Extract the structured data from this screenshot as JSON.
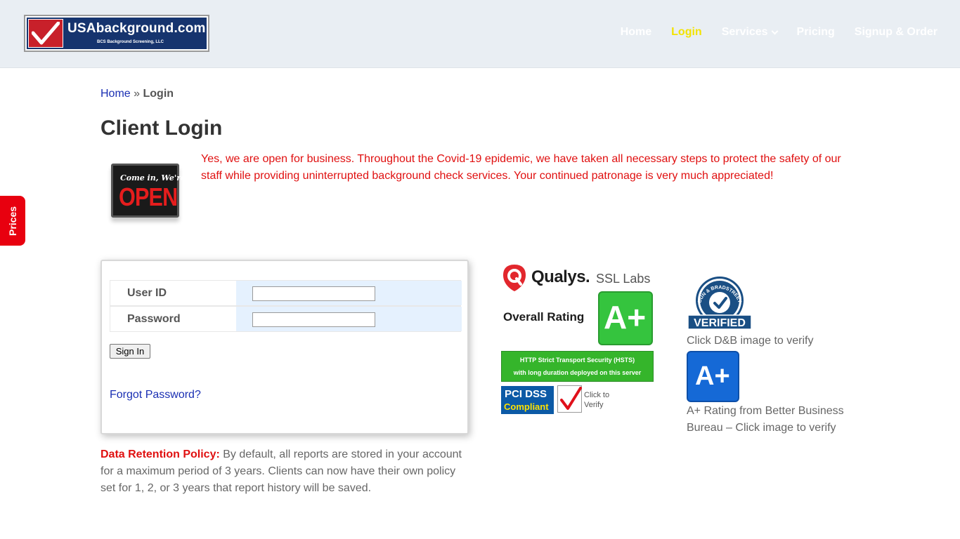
{
  "header": {
    "logo": {
      "title": "USAbackground.com",
      "subtitle": "BCS Background Screening, LLC"
    },
    "nav": [
      {
        "label": "Home",
        "active": false
      },
      {
        "label": "Login",
        "active": true
      },
      {
        "label": "Services",
        "active": false,
        "has_dropdown": true
      },
      {
        "label": "Pricing",
        "active": false
      },
      {
        "label": "Signup & Order",
        "active": false
      }
    ]
  },
  "side_tab": {
    "label": "Prices"
  },
  "breadcrumb": {
    "home": "Home",
    "separator": "»",
    "current": "Login"
  },
  "page": {
    "title": "Client Login",
    "open_sign": {
      "small": "Come in, We're",
      "big": "OPEN"
    },
    "notice": "Yes, we are open for business. Throughout the Covid-19 epidemic, we have taken all necessary steps to protect the safety of our staff while providing uninterrupted background check services. Your continued patronage is very much appreciated!"
  },
  "login_form": {
    "user_id_label": "User ID",
    "user_id_value": "",
    "password_label": "Password",
    "password_value": "",
    "sign_in_label": "Sign In",
    "forgot_label": "Forgot Password?"
  },
  "policy": {
    "heading": "Data Retention Policy:",
    "text": " By default, all reports are stored in your account for a maximum period of 3 years. Clients can now have their own policy set for 1, 2, or 3 years that report history will be saved."
  },
  "badges": {
    "qualys": {
      "name": "Qualys.",
      "ssl": "SSL Labs",
      "overall": "Overall Rating",
      "grade": "A+",
      "hsts_line1": "HTTP Strict Transport Security (HSTS)",
      "hsts_line2": "with long duration deployed on this server"
    },
    "pci": {
      "line1": "PCI DSS",
      "line2": "Compliant",
      "click": "Click to",
      "verify": "Verify"
    },
    "dnb": {
      "arc_text": "DUN & BRADSTREET",
      "verified": "VERIFIED",
      "caption": "Click D&B image to verify"
    },
    "bbb": {
      "grade": "A+",
      "caption": "A+ Rating from Better Business Bureau – Click image to verify"
    }
  },
  "colors": {
    "header_bg": "#e9eef3",
    "nav_active": "#f3e300",
    "accent_red": "#e01010",
    "link_blue": "#1a2fb3"
  }
}
